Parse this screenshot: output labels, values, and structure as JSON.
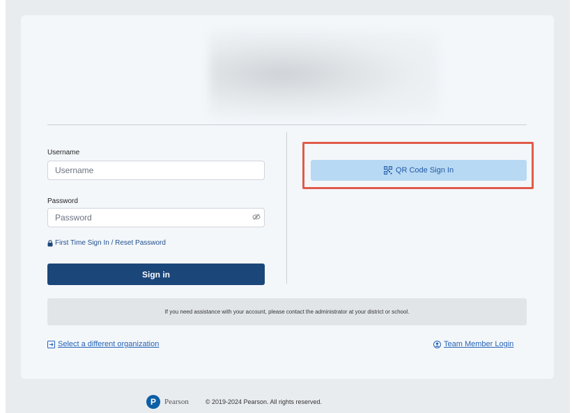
{
  "login": {
    "username_label": "Username",
    "username_placeholder": "Username",
    "password_label": "Password",
    "password_placeholder": "Password",
    "reset_link": "First Time Sign In / Reset Password",
    "signin_button": "Sign in"
  },
  "qr": {
    "button_label": "QR Code Sign In",
    "highlight_color": "#e05a4a"
  },
  "assistance": {
    "text": "If you need assistance with your account, please contact the administrator at your district or school."
  },
  "links": {
    "organization": "Select a different organization",
    "team_member": "Team Member Login"
  },
  "footer": {
    "logo_letter": "P",
    "brand": "Pearson",
    "copyright": "© 2019-2024 Pearson. All rights reserved."
  },
  "colors": {
    "primary": "#1b4679",
    "qr_button_bg": "#b8d9f3",
    "link": "#2563b8"
  }
}
